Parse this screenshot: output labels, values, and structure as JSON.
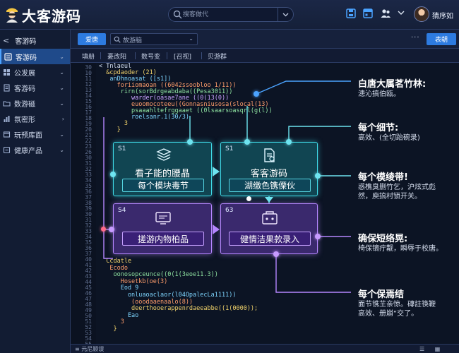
{
  "header": {
    "app_title": "大客游码",
    "search_placeholder": "搜客做代",
    "username": "猜序如"
  },
  "sidebar": {
    "heading": "客游码",
    "items": [
      {
        "label": "客游码",
        "active": true
      },
      {
        "label": "公发展",
        "active": false
      },
      {
        "label": "客游码",
        "active": false
      },
      {
        "label": "数游磁",
        "active": false
      },
      {
        "label": "氛密形",
        "active": false
      },
      {
        "label": "玩预库面",
        "active": false
      },
      {
        "label": "健康产品",
        "active": false
      }
    ]
  },
  "tabbar": {
    "active_tab": "爱唐",
    "search_text": "故游脑",
    "more": "···",
    "primary_button": "表朝"
  },
  "toolbar": {
    "items": [
      "填册",
      "憂改阳",
      "数号变",
      "[召视]",
      "贝游群"
    ]
  },
  "editor": {
    "line_numbers": [
      "30",
      "10",
      "11",
      "12",
      "13",
      "14",
      "15",
      "16",
      "17",
      "18",
      "19",
      "20",
      "21",
      "22",
      "23",
      "26",
      "30",
      "31",
      "32",
      "33",
      "34",
      "35",
      "36",
      "37",
      "38",
      "39",
      "30",
      "31",
      "32",
      "33",
      "34",
      "35",
      "36",
      "37",
      "40",
      "41",
      "42",
      "43",
      "44",
      "45",
      "46",
      "47",
      "48",
      "49",
      "50",
      "51",
      "52",
      "53",
      "54",
      "55"
    ],
    "top_lines": [
      "< Tnlaeul",
      "  &cpdaoder (21)",
      "   anDhnoasat ([s1])",
      "     foriiomaoan ((6042ssoobloo 1/11))",
      "      rirn(sorBdrgeabdaba((Pesa3011))",
      "         warder(oasae7ane ((0(13(0))",
      "         euoomocoteeu((Gonnasniusosa(slocal(13)",
      "         psaaahltefrggaaet ((0lsaarsoasqrl(g(l))",
      "         roelsanr.1(30/3)",
      "       3",
      "     }"
    ],
    "bottom_lines": [
      "  Ccdatle",
      "   Ecodo",
      "    oonosopceunce((0(1(3eoe11.3))",
      "      Hosetkb(oe(3)",
      "      Eod 9",
      "        onluaoaclaor(l04OpalecLa1111))",
      "         (ooodaaenaalo(8))",
      "         deerthooerappenrdaeeabbe((1(0000));",
      "        Eao",
      "      3",
      "    }"
    ]
  },
  "cards": [
    {
      "num": "S1",
      "line1": "看子能的腰晶",
      "pill": "每个模块毒节",
      "icon": "layers-icon",
      "color": "teal"
    },
    {
      "num": "S1",
      "line1": "客客游码",
      "pill": "湖缴色镌傈伙",
      "icon": "document-icon",
      "color": "teal"
    },
    {
      "num": "S4",
      "line1": "",
      "pill": "搓游内物柏品",
      "icon": "monitor-icon",
      "color": "purple"
    },
    {
      "num": "63",
      "line1": "",
      "pill": "健情洁果款录入",
      "icon": "database-icon",
      "color": "purple"
    }
  ],
  "annotations": [
    {
      "heading": "白唐大属茗竹林:",
      "desc": [
        "漶沁搞伯瓯。"
      ]
    },
    {
      "heading": "每个细节:",
      "desc": [
        "高效、(全切跆碗录)"
      ]
    },
    {
      "heading": "每个模绫带!",
      "desc": [
        "惑樵臭删竹乞，沪炫式彪",
        "然，庾搞村锁开关。"
      ]
    },
    {
      "heading": "确保短络晃:",
      "desc": [
        "椅保镝疔觏，瞬辱于校唐。"
      ]
    },
    {
      "heading": "每个保焉结",
      "desc": [
        "面节镌芏亲惊。磚註筷鞭",
        "高效、册崩“交了。"
      ]
    }
  ],
  "statusbar": {
    "text": "≡ 元尼顾误",
    "icons": "☰ ▦ ⚙"
  },
  "colors": {
    "background": "#0d1426",
    "accent_blue": "#2d7be0",
    "teal": "#3fd9e6",
    "purple": "#b586ff"
  }
}
